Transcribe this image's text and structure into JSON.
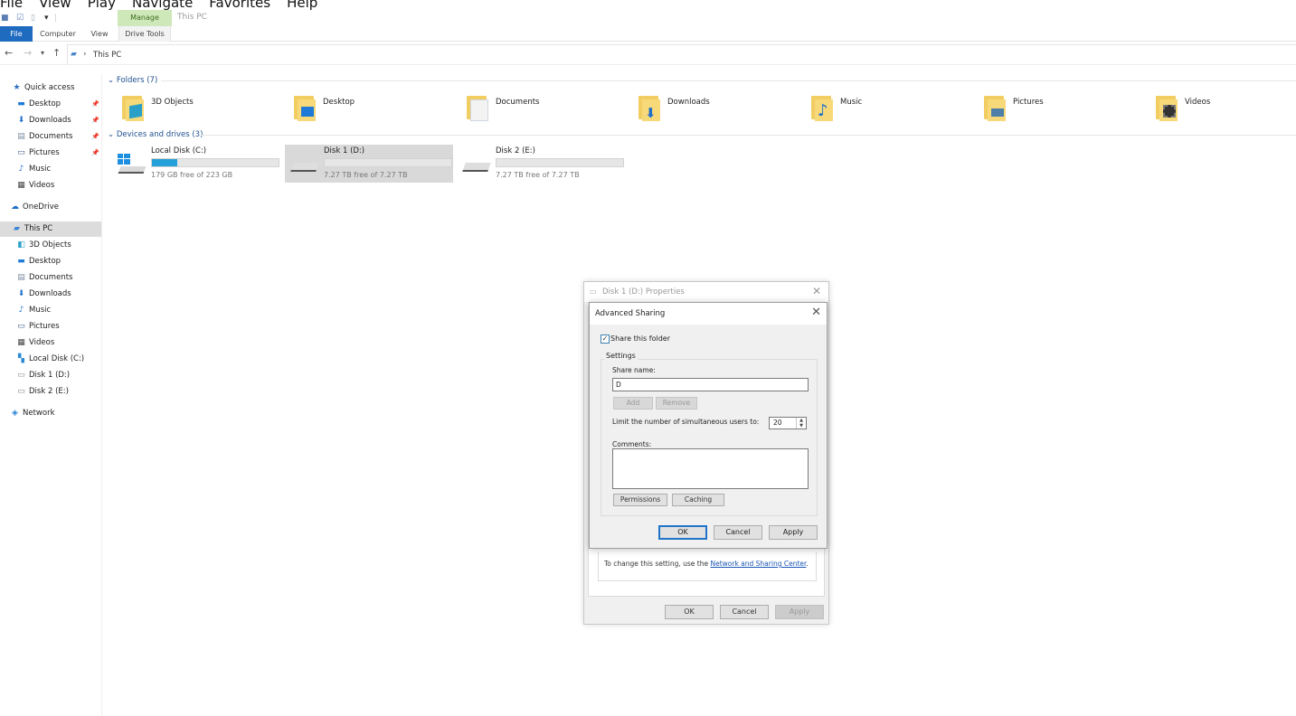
{
  "player_menu": [
    "File",
    "View",
    "Play",
    "Navigate",
    "Favorites",
    "Help"
  ],
  "ribbon": {
    "manage_tab": "Manage",
    "window_title": "This PC",
    "tabs": {
      "file": "File",
      "computer": "Computer",
      "view": "View",
      "drive_tools": "Drive Tools"
    }
  },
  "address": {
    "path": "This PC",
    "separator": "›"
  },
  "sidebar": {
    "quick_access": "Quick access",
    "quick_items": [
      "Desktop",
      "Downloads",
      "Documents",
      "Pictures",
      "Music",
      "Videos"
    ],
    "onedrive": "OneDrive",
    "this_pc": "This PC",
    "pc_items": [
      "3D Objects",
      "Desktop",
      "Documents",
      "Downloads",
      "Music",
      "Pictures",
      "Videos",
      "Local Disk (C:)",
      "Disk 1 (D:)",
      "Disk 2 (E:)"
    ],
    "network": "Network"
  },
  "folders": {
    "header": "Folders (7)",
    "items": [
      "3D Objects",
      "Desktop",
      "Documents",
      "Downloads",
      "Music",
      "Pictures",
      "Videos"
    ]
  },
  "drives": {
    "header": "Devices and drives (3)",
    "items": [
      {
        "name": "Local Disk (C:)",
        "free": "179 GB free of 223 GB",
        "used_fraction": 0.2
      },
      {
        "name": "Disk 1 (D:)",
        "free": "7.27 TB free of 7.27 TB",
        "used_fraction": 0.0
      },
      {
        "name": "Disk 2 (E:)",
        "free": "7.27 TB free of 7.27 TB",
        "used_fraction": 0.0
      }
    ]
  },
  "properties_dialog": {
    "title": "Disk 1 (D:) Properties",
    "info_text": "To change this setting, use the ",
    "info_link": "Network and Sharing Center",
    "info_end": ".",
    "ok": "OK",
    "cancel": "Cancel",
    "apply": "Apply"
  },
  "advanced_sharing": {
    "title": "Advanced Sharing",
    "share_checkbox": "Share this folder",
    "share_checked": true,
    "settings_label": "Settings",
    "share_name_label": "Share name:",
    "share_name_value": "D",
    "add": "Add",
    "remove": "Remove",
    "limit_label": "Limit the number of simultaneous users to:",
    "limit_value": "20",
    "comments_label": "Comments:",
    "permissions": "Permissions",
    "caching": "Caching",
    "ok": "OK",
    "cancel": "Cancel",
    "apply": "Apply"
  },
  "colors": {
    "accent": "#1f6bbf",
    "manage_tab": "#cfe8b9",
    "drive_fill": "#26a0da"
  }
}
